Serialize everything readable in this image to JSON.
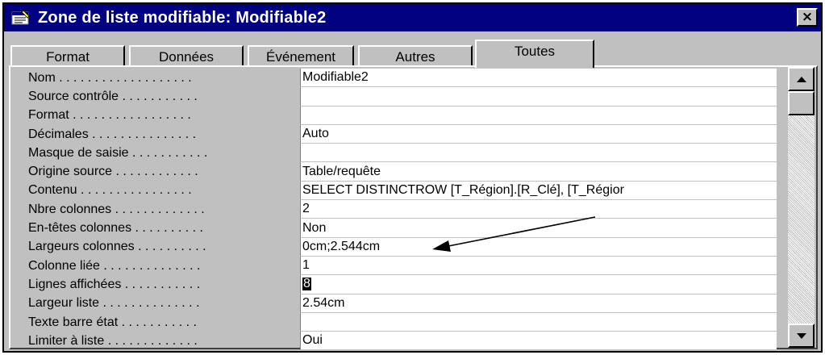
{
  "window": {
    "title": "Zone de liste modifiable: Modifiable2",
    "close_label": "×"
  },
  "tabs": [
    {
      "label": "Format"
    },
    {
      "label": "Données"
    },
    {
      "label": "Événement"
    },
    {
      "label": "Autres"
    },
    {
      "label": "Toutes",
      "active": true
    }
  ],
  "properties": [
    {
      "label": "Nom . . . . . . . . . . . . . . . . . . .",
      "value": "Modifiable2"
    },
    {
      "label": "Source contrôle . . . . . . . . . . .",
      "value": ""
    },
    {
      "label": "Format . . . . . . . . . . . . . . . . .",
      "value": ""
    },
    {
      "label": "Décimales . . . . . . . . . . . . . . .",
      "value": "Auto"
    },
    {
      "label": "Masque de saisie . . . . . . . . . . .",
      "value": ""
    },
    {
      "label": "Origine source . . . . . . . . . . . .",
      "value": "Table/requête"
    },
    {
      "label": "Contenu . . . . . . . . . . . . . . . .",
      "value": "SELECT DISTINCTROW [T_Région].[R_Clé], [T_Régior"
    },
    {
      "label": "Nbre colonnes . . . . . . . . . . . . .",
      "value": "2"
    },
    {
      "label": "En-têtes colonnes . . . . . . . . . .",
      "value": "Non"
    },
    {
      "label": "Largeurs colonnes . . . . . . . . . .",
      "value": "0cm;2.544cm"
    },
    {
      "label": "Colonne liée . . . . . . . . . . . . . .",
      "value": "1"
    },
    {
      "label": "Lignes affichées . . . . . . . . . . .",
      "value": "8",
      "selected": true
    },
    {
      "label": "Largeur liste . . . . . . . . . . . . . .",
      "value": "2.54cm"
    },
    {
      "label": "Texte barre état . . . . . . . . . . .",
      "value": ""
    },
    {
      "label": "Limiter à liste . . . . . . . . . . . . .",
      "value": "Oui"
    }
  ],
  "icons": {
    "title": "property-sheet-icon",
    "scroll_up": "triangle-up-icon",
    "scroll_down": "triangle-down-icon"
  },
  "colors": {
    "titlebar": "#000080",
    "face": "#c0c0c0",
    "field": "#ffffff"
  }
}
